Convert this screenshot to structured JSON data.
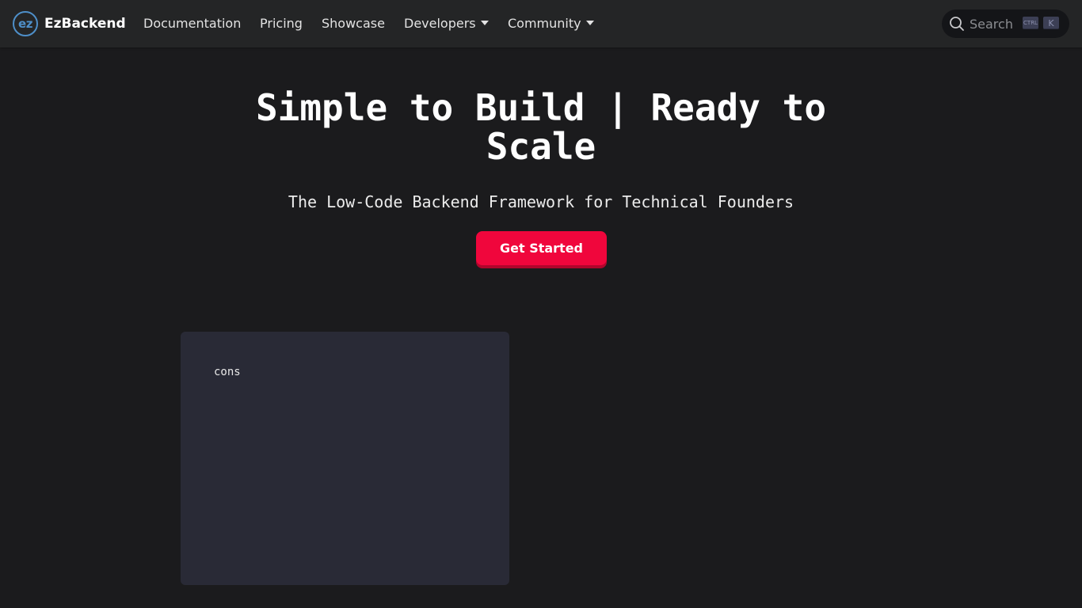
{
  "navbar": {
    "brand": {
      "logo_text": "ez",
      "name": "EzBackend"
    },
    "links": [
      {
        "label": "Documentation"
      },
      {
        "label": "Pricing"
      },
      {
        "label": "Showcase"
      },
      {
        "label": "Developers",
        "dropdown": true
      },
      {
        "label": "Community",
        "dropdown": true
      }
    ],
    "search": {
      "label": "Search",
      "shortcut_modifier": "CTRL",
      "shortcut_key": "K"
    }
  },
  "hero": {
    "title": "Simple to Build | Ready to Scale",
    "subtitle": "The Low-Code Backend Framework for Technical Founders",
    "cta_label": "Get Started"
  },
  "code_panel": {
    "text": "cons"
  },
  "colors": {
    "background": "#1b1b1d",
    "navbar": "#242526",
    "accent": "#f0063c",
    "logo": "#4e8fc9",
    "code_panel": "#292a36"
  }
}
